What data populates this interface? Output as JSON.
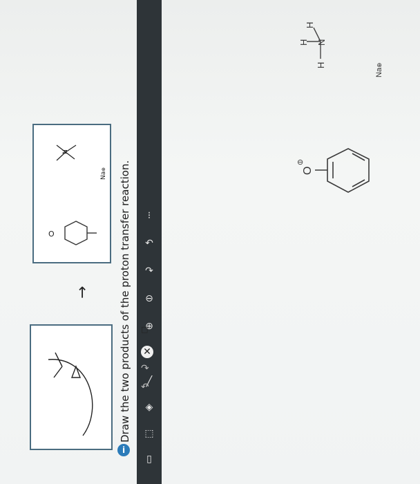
{
  "question": {
    "text": "Draw the two products of the proton transfer reaction."
  },
  "reaction_preview": {
    "mechanism_panel": {
      "atoms": [
        "H",
        "N",
        "H",
        "H",
        "O"
      ]
    },
    "product_panel": {
      "ion_label": "Na",
      "charge": "⊕",
      "amine_atoms": [
        "H",
        "H",
        "H",
        "N"
      ],
      "phenoxide_atom": "O"
    },
    "arrow": "→"
  },
  "canvas": {
    "phenoxide_oxygen": "O",
    "phenoxide_charge": "⊖",
    "amine": {
      "h1": "H",
      "h2": "H",
      "h3": "H",
      "n": "N"
    },
    "sodium": {
      "label": "Na",
      "charge": "⊕"
    }
  },
  "toolbar": {
    "icons": [
      "delete-icon",
      "select-icon",
      "eraser-icon",
      "bond-icon",
      "chain-icon",
      "add-charge-icon",
      "remove-charge-icon",
      "atom-arrow-icon",
      "lasso-icon",
      "lone-pair-icon"
    ],
    "top_controls": [
      "undo-icon",
      "redo-icon",
      "clear-icon",
      "template-icon"
    ]
  },
  "colors": {
    "toolbar": "#2e3438",
    "info_badge": "#2b7bb9",
    "ink": "#1c1c1c"
  }
}
